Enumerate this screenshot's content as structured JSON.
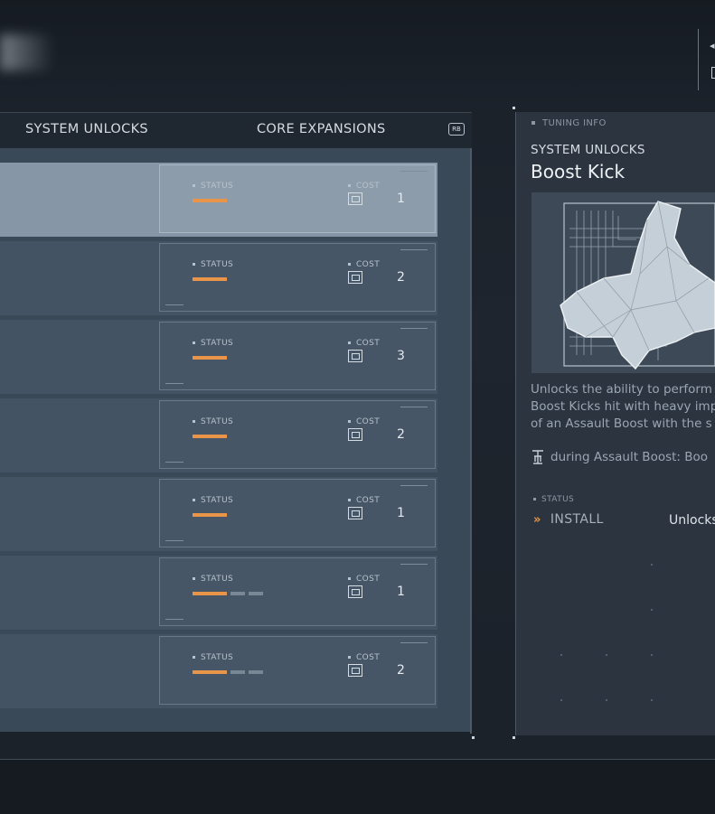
{
  "tabs": {
    "system_unlocks": "SYSTEM UNLOCKS",
    "core_expansions": "CORE EXPANSIONS",
    "rb_hint": "RB"
  },
  "rows": [
    {
      "status_label": "STATUS",
      "cost_label": "COST",
      "cost": "1",
      "status_progress": 1,
      "status_segments": 1,
      "selected": true
    },
    {
      "status_label": "STATUS",
      "cost_label": "COST",
      "cost": "2",
      "status_progress": 1,
      "status_segments": 1,
      "selected": false
    },
    {
      "status_label": "STATUS",
      "cost_label": "COST",
      "cost": "3",
      "status_progress": 1,
      "status_segments": 1,
      "selected": false
    },
    {
      "status_label": "STATUS",
      "cost_label": "COST",
      "cost": "2",
      "status_progress": 1,
      "status_segments": 1,
      "selected": false
    },
    {
      "status_label": "STATUS",
      "cost_label": "COST",
      "cost": "1",
      "status_progress": 1,
      "status_segments": 1,
      "selected": false
    },
    {
      "status_label": "STATUS",
      "cost_label": "COST",
      "cost": "1",
      "status_progress": 1,
      "status_segments": 3,
      "selected": false
    },
    {
      "status_label": "STATUS",
      "cost_label": "COST",
      "cost": "2",
      "status_progress": 1,
      "status_segments": 3,
      "selected": false
    }
  ],
  "info": {
    "header": "TUNING INFO",
    "category": "SYSTEM UNLOCKS",
    "title": "Boost Kick",
    "desc_line1": "Unlocks the ability to perform",
    "desc_line2": "Boost Kicks hit with heavy imp",
    "desc_line3": "of an Assault Boost with the s",
    "control_text": "during Assault Boost: Boo",
    "status_label": "STATUS",
    "install_label": "INSTALL",
    "unlock_text": "Unlocks"
  },
  "colors": {
    "accent": "#e8954a",
    "panel": "#3a4958",
    "selected_row": "#8696a6"
  }
}
